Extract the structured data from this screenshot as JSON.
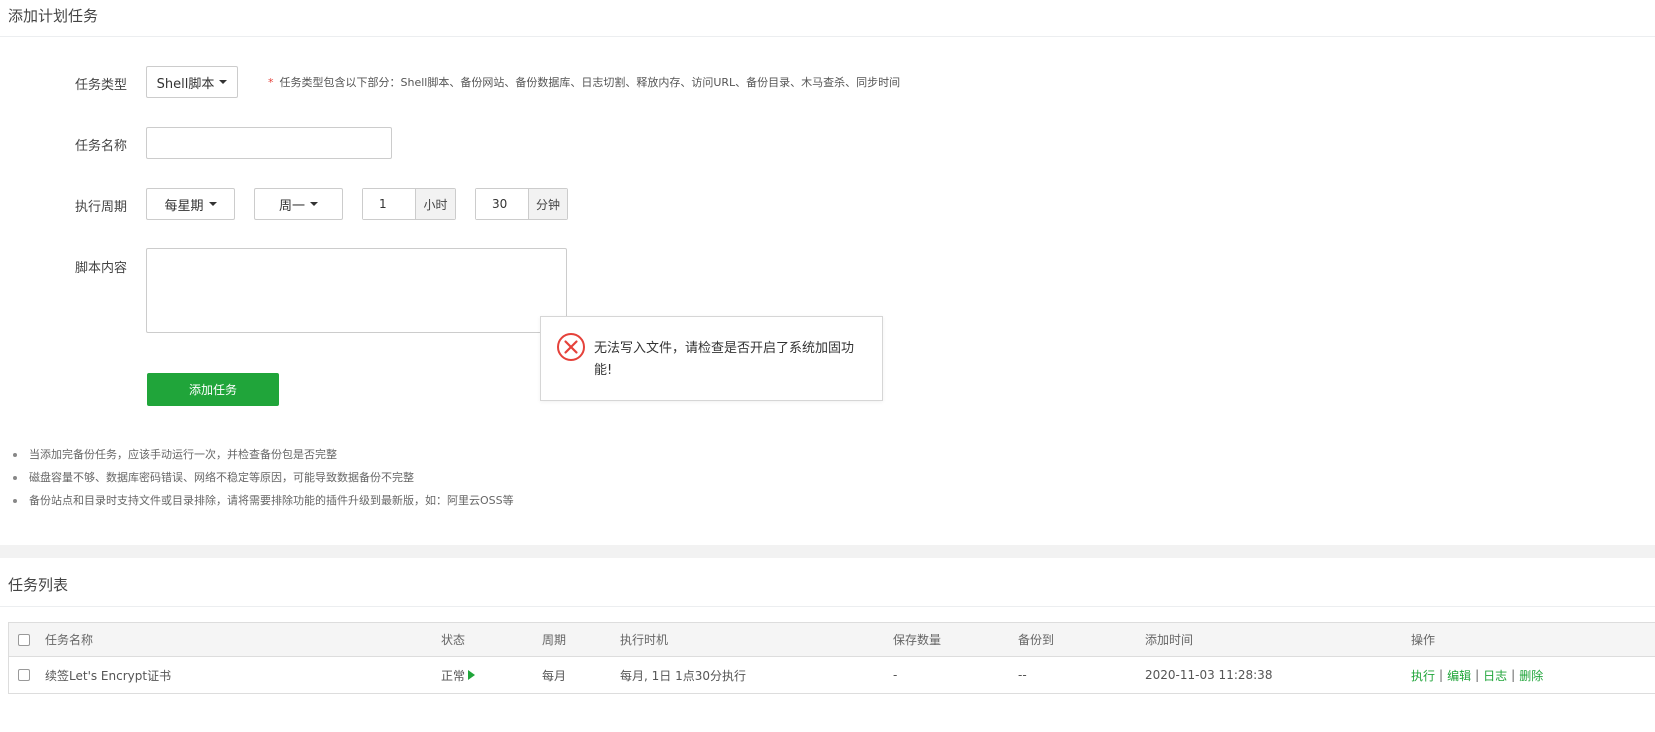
{
  "form": {
    "title": "添加计划任务",
    "task_type": {
      "label": "任务类型",
      "selected": "Shell脚本"
    },
    "tip": {
      "star": "*",
      "text": "任务类型包含以下部分：Shell脚本、备份网站、备份数据库、日志切割、释放内存、访问URL、备份目录、木马查杀、同步时间"
    },
    "task_name": {
      "label": "任务名称",
      "value": "",
      "placeholder": ""
    },
    "cycle": {
      "label": "执行周期",
      "period": "每星期",
      "weekday": "周一",
      "hour": "1",
      "hour_unit": "小时",
      "minute": "30",
      "minute_unit": "分钟"
    },
    "script": {
      "label": "脚本内容",
      "value": ""
    },
    "submit_label": "添加任务"
  },
  "notes": [
    "当添加完备份任务，应该手动运行一次，并检查备份包是否完整",
    "磁盘容量不够、数据库密码错误、网络不稳定等原因，可能导致数据备份不完整",
    "备份站点和目录时支持文件或目录排除，请将需要排除功能的插件升级到最新版，如：阿里云OSS等"
  ],
  "error_dialog": {
    "message": "无法写入文件，请检查是否开启了系统加固功能!",
    "icon": "error-circle-x-icon",
    "color": "#e5413a"
  },
  "task_list": {
    "title": "任务列表",
    "columns": [
      "任务名称",
      "状态",
      "周期",
      "执行时机",
      "保存数量",
      "备份到",
      "添加时间",
      "操作"
    ],
    "rows": [
      {
        "name": "续签Let's Encrypt证书",
        "status": "正常",
        "cycle": "每月",
        "timing": "每月, 1日 1点30分执行",
        "save_count": "-",
        "backup_to": "--",
        "added": "2020-11-03 11:28:38",
        "actions": [
          "执行",
          "编辑",
          "日志",
          "删除"
        ],
        "separator": "|"
      }
    ]
  },
  "colors": {
    "accent": "#20a53a",
    "error": "#e5413a"
  }
}
